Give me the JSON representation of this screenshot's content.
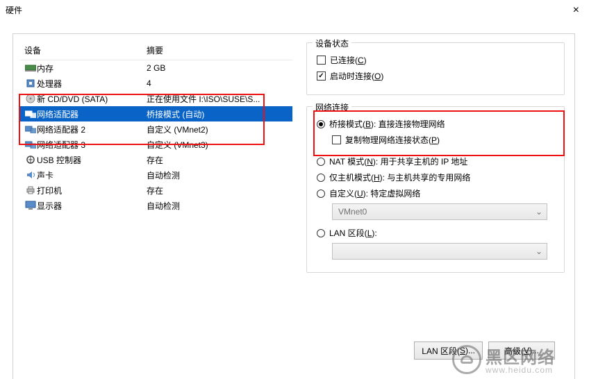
{
  "window": {
    "title": "硬件",
    "close": "×"
  },
  "columns": {
    "device": "设备",
    "summary": "摘要"
  },
  "rows": [
    {
      "icon": "memory",
      "name": "内存",
      "summary": "2 GB",
      "sel": false
    },
    {
      "icon": "cpu",
      "name": "处理器",
      "summary": "4",
      "sel": false
    },
    {
      "icon": "disc",
      "name": "新 CD/DVD (SATA)",
      "summary": "正在使用文件 I:\\ISO\\SUSE\\S...",
      "sel": false
    },
    {
      "icon": "net",
      "name": "网络适配器",
      "summary": "桥接模式 (自动)",
      "sel": true
    },
    {
      "icon": "net",
      "name": "网络适配器 2",
      "summary": "自定义 (VMnet2)",
      "sel": false
    },
    {
      "icon": "net",
      "name": "网络适配器 3",
      "summary": "自定义 (VMnet3)",
      "sel": false
    },
    {
      "icon": "usb",
      "name": "USB 控制器",
      "summary": "存在",
      "sel": false
    },
    {
      "icon": "sound",
      "name": "声卡",
      "summary": "自动检测",
      "sel": false
    },
    {
      "icon": "printer",
      "name": "打印机",
      "summary": "存在",
      "sel": false
    },
    {
      "icon": "display",
      "name": "显示器",
      "summary": "自动检测",
      "sel": false
    }
  ],
  "status": {
    "group": "设备状态",
    "connected": {
      "label": "已连接(",
      "accel": "C",
      "tail": ")",
      "checked": false
    },
    "connect_on": {
      "label": "启动时连接(",
      "accel": "O",
      "tail": ")",
      "checked": true
    }
  },
  "net": {
    "group": "网络连接",
    "bridged": {
      "label": "桥接模式(",
      "accel": "B",
      "mid": "): 直接连接物理网络",
      "checked": true
    },
    "replicate": {
      "label": "复制物理网络连接状态(",
      "accel": "P",
      "tail": ")",
      "checked": false
    },
    "nat": {
      "label": "NAT 模式(",
      "accel": "N",
      "mid": "): 用于共享主机的 IP 地址"
    },
    "host": {
      "label": "仅主机模式(",
      "accel": "H",
      "mid": "): 与主机共享的专用网络"
    },
    "custom": {
      "label": "自定义(",
      "accel": "U",
      "mid": "): 特定虚拟网络"
    },
    "vmnet_sel": "VMnet0",
    "lanseg": {
      "label": "LAN 区段(",
      "accel": "L",
      "tail": "):"
    },
    "seg_select": ""
  },
  "buttons": {
    "lanseg": {
      "label": "LAN 区段(",
      "accel": "S",
      "tail": ")..."
    },
    "adv": {
      "label": "高级(",
      "accel": "V",
      "tail": ")..."
    }
  },
  "watermark": {
    "l1": "黑区网络",
    "l2": "www.heidu.com"
  }
}
